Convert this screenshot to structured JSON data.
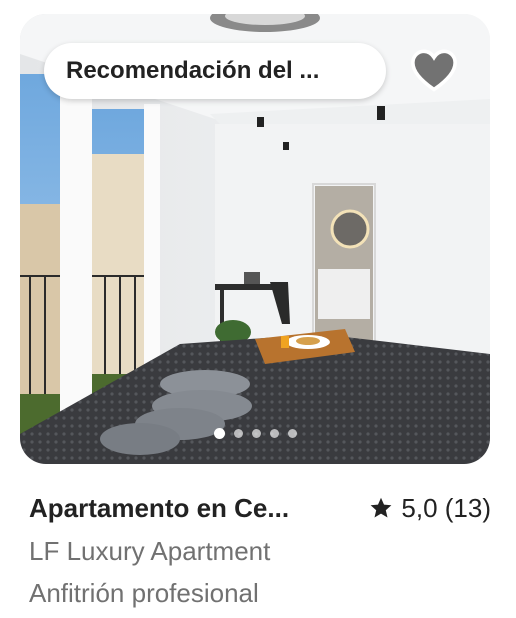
{
  "listing": {
    "badge": "Recomendación del ...",
    "title": "Apartamento en Ce...",
    "rating": "5,0 (13)",
    "host_name": "LF Luxury Apartment",
    "host_type": "Anfitrión profesional"
  },
  "carousel": {
    "total_photos": 5,
    "active_index": 0
  },
  "icons": {
    "favorite": "heart-icon",
    "rating": "star-icon"
  },
  "colors": {
    "text_primary": "#222222",
    "text_secondary": "#717171",
    "heart_fill": "#5a5a5a"
  }
}
